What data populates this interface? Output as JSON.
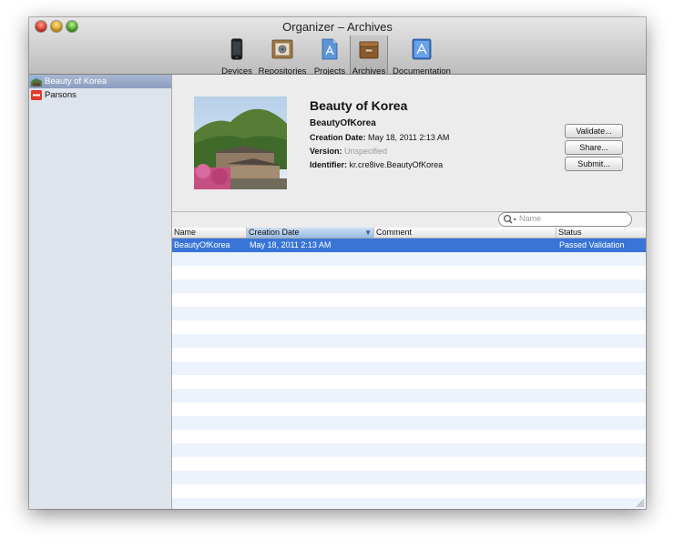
{
  "window": {
    "title": "Organizer – Archives"
  },
  "toolbar": {
    "items": [
      {
        "label": "Devices",
        "icon": "iphone-icon"
      },
      {
        "label": "Repositories",
        "icon": "repositories-icon"
      },
      {
        "label": "Projects",
        "icon": "projects-icon"
      },
      {
        "label": "Archives",
        "icon": "archive-box-icon",
        "active": true
      },
      {
        "label": "Documentation",
        "icon": "documentation-icon"
      }
    ]
  },
  "sidebar": {
    "items": [
      {
        "label": "Beauty of Korea",
        "selected": true
      },
      {
        "label": "Parsons",
        "selected": false
      }
    ]
  },
  "detail": {
    "title": "Beauty of Korea",
    "app_name": "BeautyOfKorea",
    "creation_date_label": "Creation Date:",
    "creation_date": "May 18, 2011 2:13 AM",
    "version_label": "Version:",
    "version": "Unspecified",
    "identifier_label": "Identifier:",
    "identifier": "kr.cre8ive.BeautyOfKorea",
    "buttons": {
      "validate": "Validate...",
      "share": "Share...",
      "submit": "Submit..."
    }
  },
  "search": {
    "placeholder": "Name"
  },
  "table": {
    "columns": [
      "Name",
      "Creation Date",
      "Comment",
      "Status"
    ],
    "sorted_column": "Creation Date",
    "rows": [
      {
        "name": "BeautyOfKorea",
        "creation_date": "May 18, 2011 2:13 AM",
        "comment": "",
        "status": "Passed Validation",
        "selected": true
      }
    ]
  },
  "colors": {
    "selection": "#3875d7",
    "stripe": "#edf3fd",
    "sidebar": "#dee4ec"
  }
}
